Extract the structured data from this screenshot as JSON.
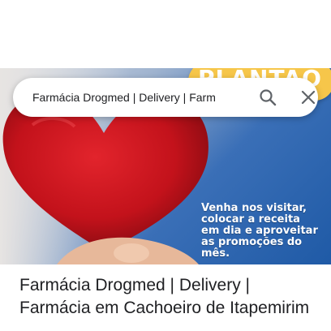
{
  "search": {
    "query": "Farmácia Drogmed | Delivery | Farm"
  },
  "hero": {
    "banner_text": "PLANTÃO",
    "promo_lines": [
      "Venha nos visitar,",
      "colocar a receita",
      "em dia e aproveitar",
      "as promoções do",
      "mês."
    ]
  },
  "result": {
    "title": "Farmácia Drogmed | Delivery | Farmácia em Cachoeiro de Itapemirim"
  },
  "colors": {
    "badge": "#f6c64a",
    "heart": "#d0141f",
    "hero_blue": "#1f5aa6"
  }
}
